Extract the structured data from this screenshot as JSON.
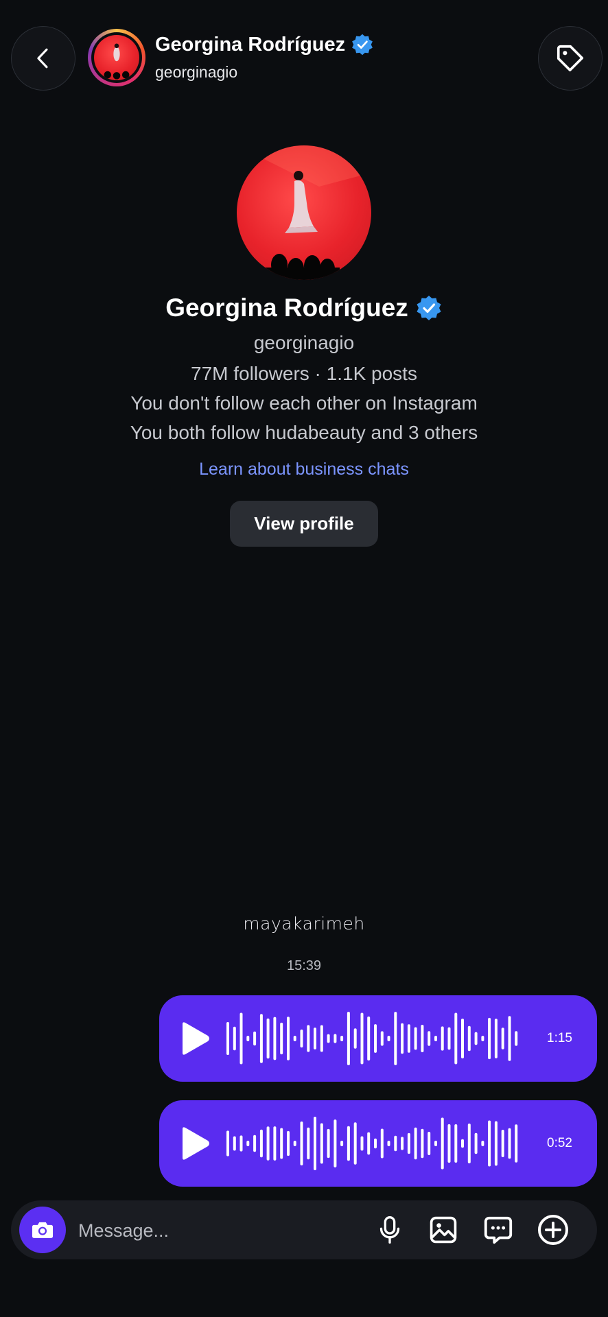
{
  "header": {
    "name": "Georgina Rodríguez",
    "username": "georginagio"
  },
  "profile": {
    "name": "Georgina Rodríguez",
    "username": "georginagio",
    "stats": "77M followers · 1.1K posts",
    "follow_status": "You don't follow each other on Instagram",
    "mutuals": "You both follow hudabeauty and 3 others",
    "business_link": "Learn about business chats",
    "view_profile_label": "View profile"
  },
  "overlay_text": "mayakarimeh",
  "timestamp": "15:39",
  "messages": [
    {
      "type": "voice",
      "duration": "1:15"
    },
    {
      "type": "voice",
      "duration": "0:52"
    }
  ],
  "composer": {
    "placeholder": "Message..."
  },
  "colors": {
    "background": "#0b0d10",
    "bubble": "#5a2cf0",
    "camera_button": "#5b2ff2",
    "link": "#7c95ff",
    "verified": "#3897f0"
  },
  "icons": [
    "back-chevron-icon",
    "tag-icon",
    "verified-badge-icon",
    "play-icon",
    "camera-icon",
    "microphone-icon",
    "gallery-icon",
    "sticker-chat-icon",
    "plus-circle-icon"
  ]
}
